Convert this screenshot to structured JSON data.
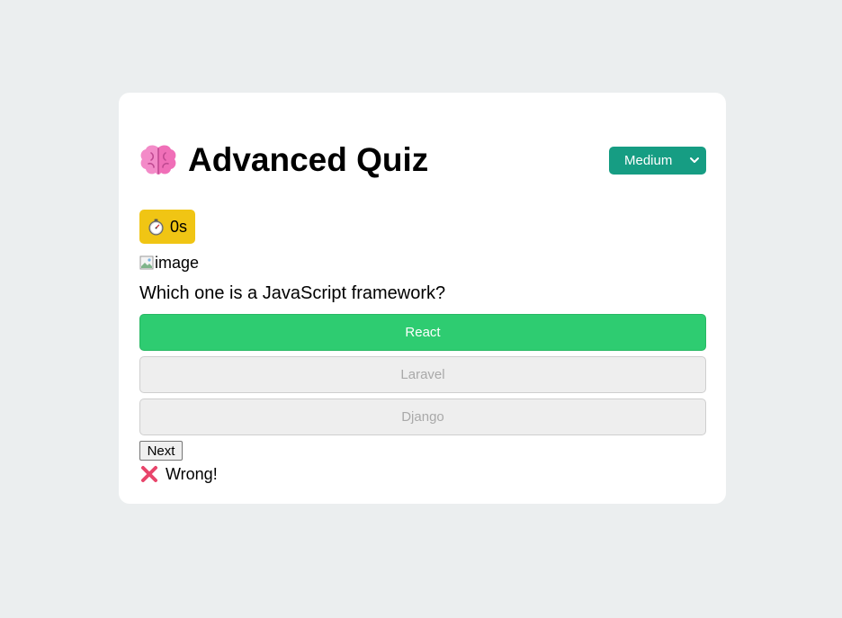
{
  "header": {
    "title": "Advanced Quiz",
    "title_icon": "brain-icon",
    "difficulty": {
      "selected": "Medium",
      "icon": "chevron-down-icon",
      "background": "#169d83"
    }
  },
  "timer": {
    "icon": "stopwatch-icon",
    "value": "0s",
    "background": "#f0c514"
  },
  "question": {
    "image_alt": "image",
    "text": "Which one is a JavaScript framework?",
    "options": [
      {
        "label": "React",
        "state": "correct"
      },
      {
        "label": "Laravel",
        "state": "disabled"
      },
      {
        "label": "Django",
        "state": "disabled"
      }
    ]
  },
  "controls": {
    "next_label": "Next"
  },
  "feedback": {
    "icon": "cross-icon",
    "text": "Wrong!"
  },
  "colors": {
    "page_background": "#ebeeef",
    "card_background": "#ffffff",
    "correct": "#2ecc71",
    "disabled": "#eeeeee"
  }
}
